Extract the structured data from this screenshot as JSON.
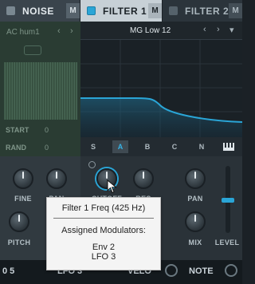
{
  "header": {
    "tabs": [
      {
        "name": "NOISE",
        "mod": "M"
      },
      {
        "name": "FILTER 1",
        "mod": "M"
      },
      {
        "name": "FILTER 2",
        "mod": "M"
      }
    ]
  },
  "noise": {
    "sample": "AC hum1",
    "prev": "‹",
    "next": "›",
    "start_label": "START",
    "start_value": "0",
    "rand_label": "RAND",
    "rand_value": "0"
  },
  "filter1": {
    "preset": "MG Low 12",
    "prev": "‹",
    "next": "›",
    "menu": "▾",
    "types": [
      "S",
      "A",
      "B",
      "C",
      "N"
    ],
    "active_type": "A",
    "knobs": {
      "fine": "FINE",
      "pan_left": "PAN",
      "pitch": "PITCH",
      "cutoff": "CUTOFF",
      "res": "RES",
      "pan": "PAN",
      "mix": "MIX",
      "level": "LEVEL"
    }
  },
  "bottom_tabs": [
    "0 5",
    "LFO 3",
    "VELO",
    "NOTE"
  ],
  "tooltip": {
    "title": "Filter 1 Freq (425 Hz)",
    "heading": "Assigned Modulators:",
    "modulators": [
      "Env 2",
      "LFO 3"
    ]
  },
  "colors": {
    "accent": "#2aa5d6",
    "curve": "#2aa5d6",
    "noise_panel": "#2a3c33"
  }
}
